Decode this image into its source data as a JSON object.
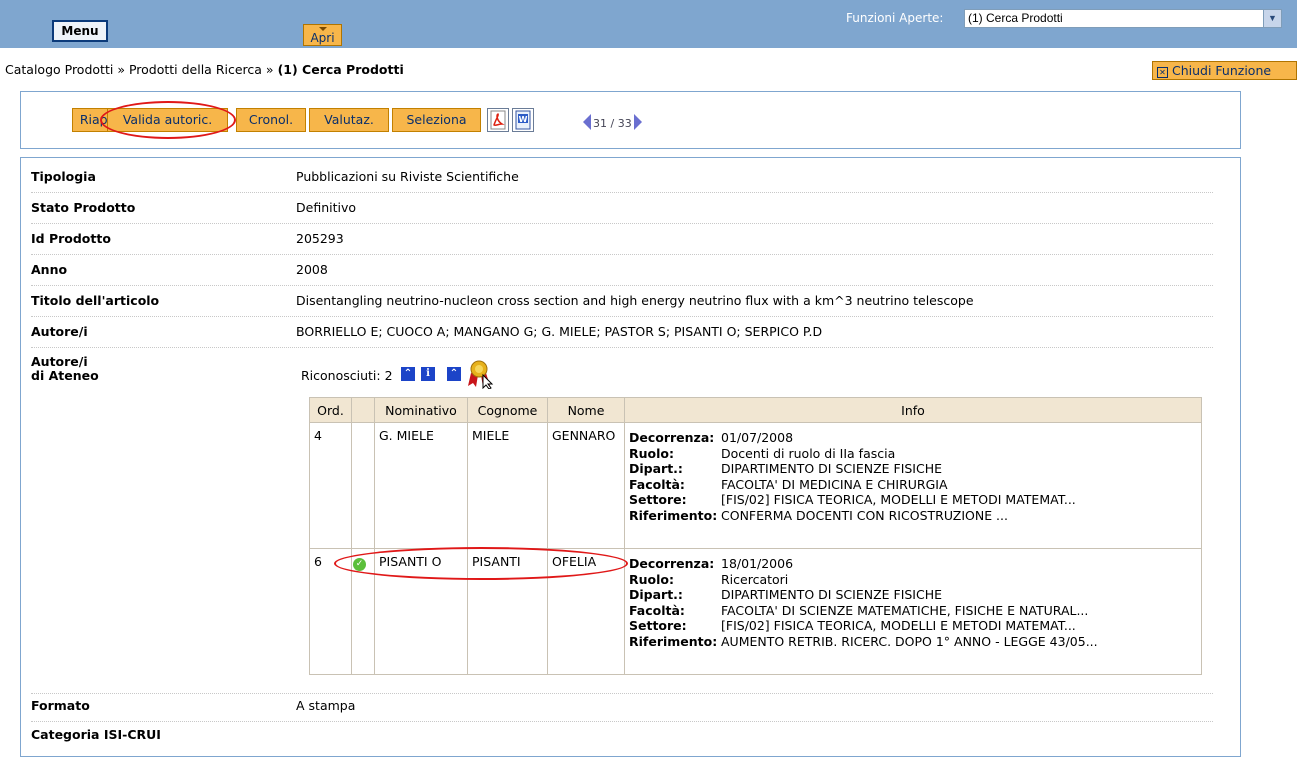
{
  "header": {
    "menu_label": "Menu",
    "open_label": "Apri",
    "open_functions_label": "Funzioni Aperte:",
    "open_functions_value": "(1) Cerca Prodotti"
  },
  "breadcrumb": {
    "part1": "Catalogo Prodotti",
    "sep": "»",
    "part2": "Prodotti della Ricerca",
    "current": "(1) Cerca Prodotti"
  },
  "close_function_label": "Chiudi Funzione",
  "toolbar": {
    "reopen": "Riapri",
    "validate": "Valida autoric.",
    "chronology": "Cronol.",
    "evaluate": "Valutaz.",
    "select": "Seleziona",
    "pager": "31 / 33"
  },
  "fields": [
    {
      "label": "Tipologia",
      "value": "Pubblicazioni su Riviste Scientifiche"
    },
    {
      "label": "Stato Prodotto",
      "value": "Definitivo"
    },
    {
      "label": "Id Prodotto",
      "value": "205293"
    },
    {
      "label": "Anno",
      "value": "2008"
    },
    {
      "label": "Titolo dell'articolo",
      "value": "Disentangling neutrino-nucleon cross section and high energy neutrino flux with a km^3 neutrino telescope"
    },
    {
      "label": "Autore/i",
      "value": "BORRIELLO E; CUOCO A; MANGANO G; G. MIELE; PASTOR S; PISANTI O; SERPICO P.D"
    }
  ],
  "authors_section": {
    "label_line1": "Autore/i",
    "label_line2": "di Ateneo",
    "recognized": "Riconosciuti: 2"
  },
  "authors_table": {
    "headers": [
      "Ord.",
      "",
      "Nominativo",
      "Cognome",
      "Nome",
      "Info"
    ],
    "info_keys": [
      "Decorrenza:",
      "Ruolo:",
      "Dipart.:",
      "Facoltà:",
      "Settore:",
      "Riferimento:"
    ],
    "rows": [
      {
        "ord": "4",
        "nominativo": "G. MIELE",
        "cognome": "MIELE",
        "nome": "GENNARO",
        "decorrenza": "01/07/2008",
        "ruolo": "Docenti di ruolo di IIa fascia",
        "dipart": "DIPARTIMENTO DI SCIENZE FISICHE",
        "facolta": "FACOLTA' DI MEDICINA E CHIRURGIA",
        "settore": "[FIS/02] FISICA TEORICA, MODELLI E METODI MATEMAT...",
        "riferimento": "CONFERMA DOCENTI CON RICOSTRUZIONE ..."
      },
      {
        "ord": "6",
        "nominativo": "PISANTI O",
        "cognome": "PISANTI",
        "nome": "OFELIA",
        "decorrenza": "18/01/2006",
        "ruolo": "Ricercatori",
        "dipart": "DIPARTIMENTO DI SCIENZE FISICHE",
        "facolta": "FACOLTA' DI SCIENZE MATEMATICHE, FISICHE E NATURAL...",
        "settore": "[FIS/02] FISICA TEORICA, MODELLI E METODI MATEMAT...",
        "riferimento": "AUMENTO RETRIB. RICERC. DOPO 1° ANNO - LEGGE 43/05..."
      }
    ]
  },
  "format": {
    "label": "Formato",
    "value": "A stampa"
  },
  "category": {
    "label": "Categoria ISI-CRUI"
  },
  "icons": {
    "pdf": "pdf-icon",
    "word": "word-icon",
    "prev": "arrow-left-icon",
    "next": "arrow-right-icon",
    "expand": "double-chevron-up-icon",
    "info": "info-icon",
    "award": "award-ribbon-icon",
    "validated": "check-circle-icon"
  },
  "colors": {
    "topbar": "#7fa6cf",
    "button": "#f7b64a",
    "annotation": "#e01818"
  }
}
